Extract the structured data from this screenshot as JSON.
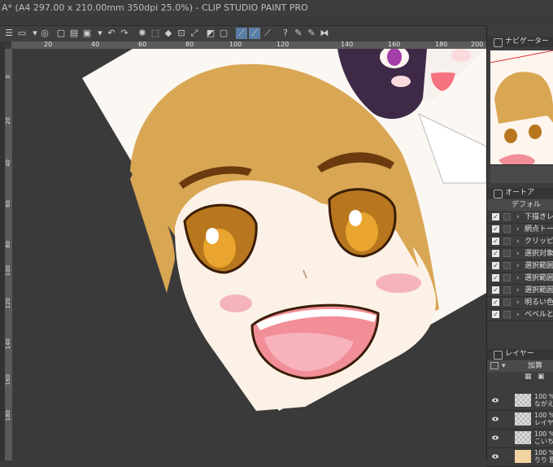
{
  "window": {
    "title": "A* (A4 297.00 x 210.00mm 350dpi 25.0%)  - CLIP STUDIO PAINT PRO"
  },
  "ruler": {
    "h_labels": [
      "20",
      "40",
      "60",
      "80",
      "100",
      "120",
      "140",
      "160",
      "180",
      "200"
    ],
    "v_labels": [
      "0",
      "20",
      "40",
      "60",
      "80",
      "100",
      "120",
      "140",
      "160",
      "180"
    ]
  },
  "panels": {
    "navigator_title": "ナビゲーター",
    "auto_action_title": "オートア",
    "auto_action_set": "デフォル",
    "actions": [
      {
        "label": "下描きレイ",
        "checked": true
      },
      {
        "label": "網点トーン",
        "checked": true
      },
      {
        "label": "クリッピング",
        "checked": true
      },
      {
        "label": "選択対象",
        "checked": true
      },
      {
        "label": "選択範囲",
        "checked": true
      },
      {
        "label": "選択範囲",
        "checked": true
      },
      {
        "label": "選択範囲",
        "checked": true
      },
      {
        "label": "明るい色な",
        "checked": true
      },
      {
        "label": "ベベルとエ",
        "checked": true
      }
    ],
    "layer_title": "レイヤー",
    "blend_mode": "加算",
    "layers": [
      {
        "line1": "100 %",
        "line2": "ながえ"
      },
      {
        "line1": "100 %",
        "line2": "レイヤ"
      },
      {
        "line1": "100 %",
        "line2": "こいち"
      },
      {
        "line1": "100 %",
        "line2": "りり 臨"
      }
    ]
  },
  "colors": {
    "accent": "#5a7fa6",
    "canvas_bg": "#3a3a3a",
    "hair": "#d9a654",
    "eye": "#b8771e",
    "blush": "#f3a9b4",
    "mouth": "#f28e97"
  }
}
